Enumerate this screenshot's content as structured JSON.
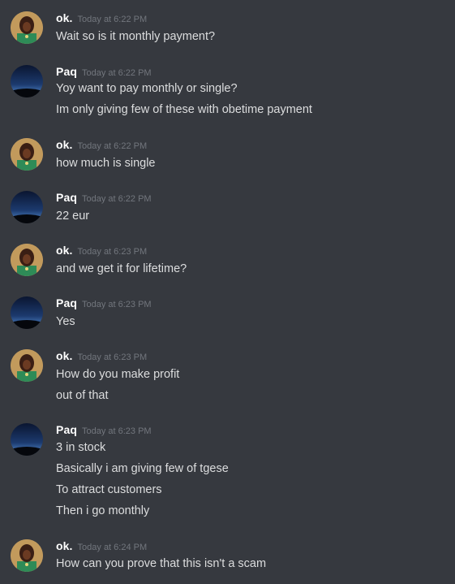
{
  "messages": [
    {
      "author": "ok.",
      "avatar": "person-green-shirt",
      "timestamp": "Today at 6:22 PM",
      "lines": [
        "Wait so is it monthly payment?"
      ]
    },
    {
      "author": "Paq",
      "avatar": "night-sky",
      "timestamp": "Today at 6:22 PM",
      "lines": [
        "Yoy want to pay monthly or single?",
        "Im only giving few of these with obetime payment"
      ]
    },
    {
      "author": "ok.",
      "avatar": "person-green-shirt",
      "timestamp": "Today at 6:22 PM",
      "lines": [
        "how much is single"
      ]
    },
    {
      "author": "Paq",
      "avatar": "night-sky",
      "timestamp": "Today at 6:22 PM",
      "lines": [
        "22 eur"
      ]
    },
    {
      "author": "ok.",
      "avatar": "person-green-shirt",
      "timestamp": "Today at 6:23 PM",
      "lines": [
        "and we get it for lifetime?"
      ]
    },
    {
      "author": "Paq",
      "avatar": "night-sky",
      "timestamp": "Today at 6:23 PM",
      "lines": [
        "Yes"
      ]
    },
    {
      "author": "ok.",
      "avatar": "person-green-shirt",
      "timestamp": "Today at 6:23 PM",
      "lines": [
        "How do you make profit",
        "out of that"
      ]
    },
    {
      "author": "Paq",
      "avatar": "night-sky",
      "timestamp": "Today at 6:23 PM",
      "lines": [
        "3 in stock",
        "Basically i am giving few of tgese",
        "To attract customers",
        "Then i go monthly"
      ]
    },
    {
      "author": "ok.",
      "avatar": "person-green-shirt",
      "timestamp": "Today at 6:24 PM",
      "lines": [
        "How can you prove that this isn't a scam"
      ]
    }
  ],
  "colors": {
    "background": "#36393f",
    "username": "#ffffff",
    "timestamp": "#72767d",
    "message_text": "#dcddde"
  }
}
